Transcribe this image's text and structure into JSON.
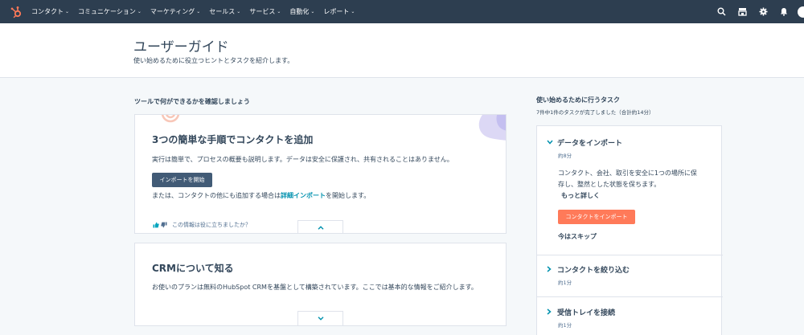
{
  "nav": {
    "items": [
      "コンタクト",
      "コミュニケーション",
      "マーケティング",
      "セールス",
      "サービス",
      "自動化",
      "レポート"
    ],
    "brand_color": "#ff7a59",
    "bg_color": "#2d3e50",
    "icons": [
      "search-icon",
      "marketplace-icon",
      "settings-icon",
      "notifications-icon"
    ]
  },
  "header": {
    "title": "ユーザーガイド",
    "subtitle": "使い始めるために役立つヒントとタスクを紹介します。"
  },
  "left": {
    "section_label": "ツールで何ができるかを確認しましょう",
    "card1": {
      "title": "3つの簡単な手順でコンタクトを追加",
      "description": "実行は簡単で、プロセスの概要も説明します。データは安全に保護され、共有されることはありません。",
      "button": "インポートを開始",
      "alt_prefix": "または、コンタクトの他にも追加する場合は",
      "alt_link": "詳細インポート",
      "alt_suffix": "を開始します。",
      "feedback": "この情報は役に立ちましたか？"
    },
    "card2": {
      "title": "CRMについて知る",
      "description": "お使いのプランは無料のHubSpot CRMを基盤として構築されています。ここでは基本的な情報をご紹介します。"
    }
  },
  "right": {
    "title": "使い始めるために行うタスク",
    "progress": "7件中1件のタスクが完了しました（合計約14分）",
    "tasks": [
      {
        "title": "データをインポート",
        "time": "約8分",
        "desc_line1": "コンタクト、会社、取引を安全に1つの場所に保",
        "desc_line2": "存し、整然とした状態を保ちます。",
        "learn_more": "もっと詳しく",
        "button": "コンタクトをインポート",
        "skip": "今はスキップ"
      },
      {
        "title": "コンタクトを絞り込む",
        "time": "約1分"
      },
      {
        "title": "受信トレイを接続",
        "time": "約1分"
      }
    ]
  }
}
